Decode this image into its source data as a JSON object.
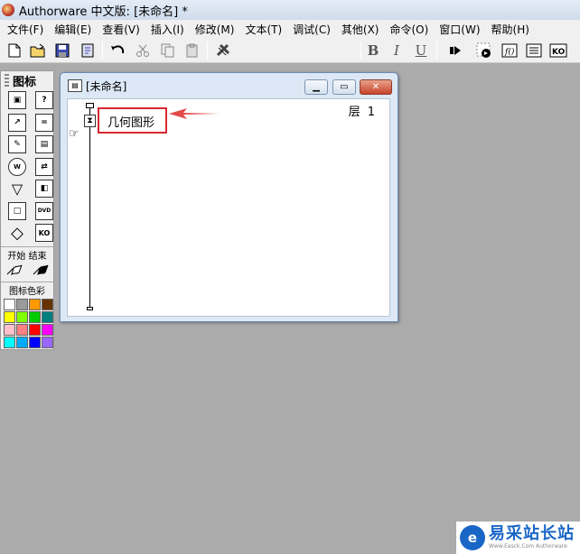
{
  "window": {
    "title": "Authorware 中文版: [未命名] *"
  },
  "menubar": {
    "items": [
      "文件(F)",
      "编辑(E)",
      "查看(V)",
      "插入(I)",
      "修改(M)",
      "文本(T)",
      "调试(C)",
      "其他(X)",
      "命令(O)",
      "窗口(W)",
      "帮助(H)"
    ]
  },
  "toolbar": {
    "bold": "B",
    "italic": "I",
    "underline": "U",
    "style_value": "",
    "icons": [
      "new-file-icon",
      "open-folder-icon",
      "save-all-icon",
      "import-icon",
      "undo-icon",
      "cut-icon",
      "copy-icon",
      "paste-icon",
      "find-icon",
      "run-icon",
      "control-panel-icon",
      "functions-icon",
      "variables-icon",
      "knowledge-objects-icon"
    ]
  },
  "palette": {
    "title": "图标",
    "start_end_label": "开始  结束",
    "color_label": "图标色彩",
    "icons": [
      "display-icon",
      "interaction-icon",
      "motion-icon",
      "calculation-icon",
      "erase-icon",
      "map-icon",
      "wait-icon",
      "digital-movie-icon",
      "navigate-icon",
      "sound-icon",
      "framework-icon",
      "dvd-icon",
      "decision-icon",
      "knowledge-object-icon"
    ],
    "colors": [
      "#ffffff",
      "#9a9a9a",
      "#ff9900",
      "#663300",
      "#ffff00",
      "#80ff00",
      "#00cc00",
      "#008080",
      "#ffc0cb",
      "#ff8080",
      "#ff0000",
      "#ff00ff",
      "#00ffff",
      "#00aaff",
      "#0000ff",
      "#9966ff"
    ]
  },
  "design_window": {
    "title": "[未命名]",
    "layer_label": "层",
    "layer_value": "1",
    "icon_title": "几何图形"
  },
  "watermark": {
    "name": "易采站长站",
    "url": "Www.Easck.Com Authorware"
  },
  "colors": {
    "desktop": "#ababab",
    "annotation_red": "#d9272e",
    "watermark_blue": "#1a66c7"
  }
}
